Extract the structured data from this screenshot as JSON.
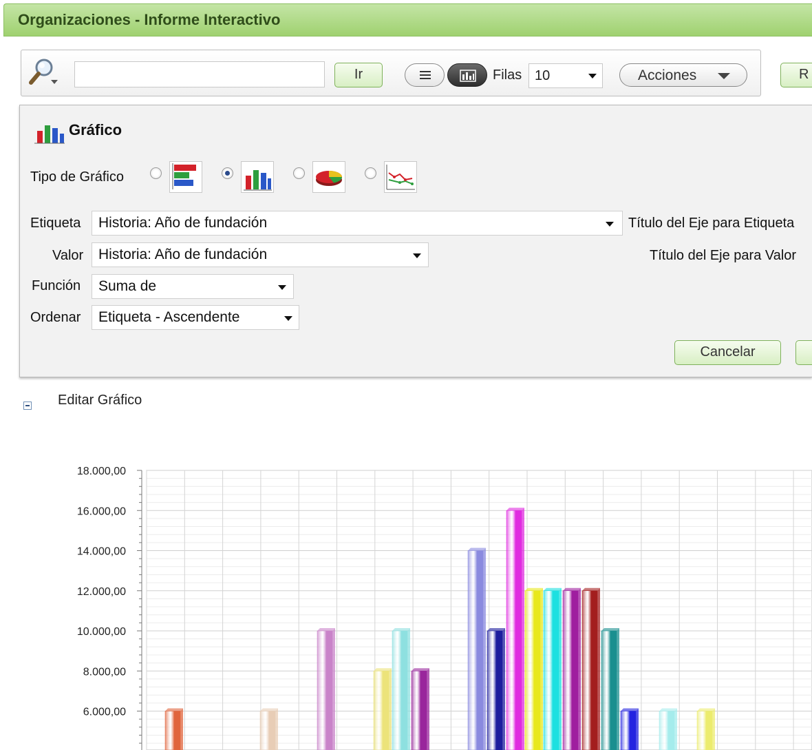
{
  "region": {
    "title": "Organizaciones - Informe Interactivo"
  },
  "toolbar": {
    "search_value": "",
    "go_label": "Ir",
    "rows_label": "Filas",
    "rows_value": "10",
    "actions_label": "Acciones",
    "cut_button_label": "R"
  },
  "chart_panel": {
    "title": "Gráfico",
    "chart_type_label": "Tipo de Gráfico",
    "chart_types": [
      {
        "icon": "horizontal-bar-chart-icon",
        "selected": false
      },
      {
        "icon": "vertical-bar-chart-icon",
        "selected": true
      },
      {
        "icon": "pie-chart-icon",
        "selected": false
      },
      {
        "icon": "line-chart-icon",
        "selected": false
      }
    ],
    "label_field": "Etiqueta",
    "label_value": "Historia: Año de fundación",
    "label_axis_title": "Título del Eje para Etiqueta",
    "value_field": "Valor",
    "value_value": "Historia: Año de fundación",
    "value_axis_title": "Título del Eje para Valor",
    "function_field": "Función",
    "function_value": "Suma de",
    "sort_field": "Ordenar",
    "sort_value": "Etiqueta - Ascendente",
    "cancel_label": "Cancelar"
  },
  "edit_chart_label": "Editar Gráfico",
  "colors": {
    "header_green": "#9fd16f",
    "button_border": "#7eb15a"
  },
  "chart_data": {
    "type": "bar",
    "ylim": [
      0,
      18000
    ],
    "ytick_labels": [
      "18.000,00",
      "16.000,00",
      "14.000,00",
      "12.000,00",
      "10.000,00",
      "8.000,00",
      "6.000,00"
    ],
    "ytick_values": [
      18000,
      16000,
      14000,
      12000,
      10000,
      8000,
      6000
    ],
    "values": [
      6000,
      6000,
      10000,
      8000,
      10000,
      8000,
      14000,
      10000,
      16000,
      12000,
      12000,
      12000,
      12000,
      10000,
      6000,
      6000,
      6000
    ],
    "bar_colors": [
      "#e0643c",
      "#e8cdb6",
      "#c983c9",
      "#ece37a",
      "#8ee0e0",
      "#99269c",
      "#8a8adf",
      "#1d1d9e",
      "#e02ce0",
      "#e8e81c",
      "#1ce0e0",
      "#9f1e9f",
      "#a31e1e",
      "#1a8f8f",
      "#2424e0",
      "#a5ecec",
      "#ecec6e"
    ],
    "grid": true,
    "legend": "none"
  }
}
